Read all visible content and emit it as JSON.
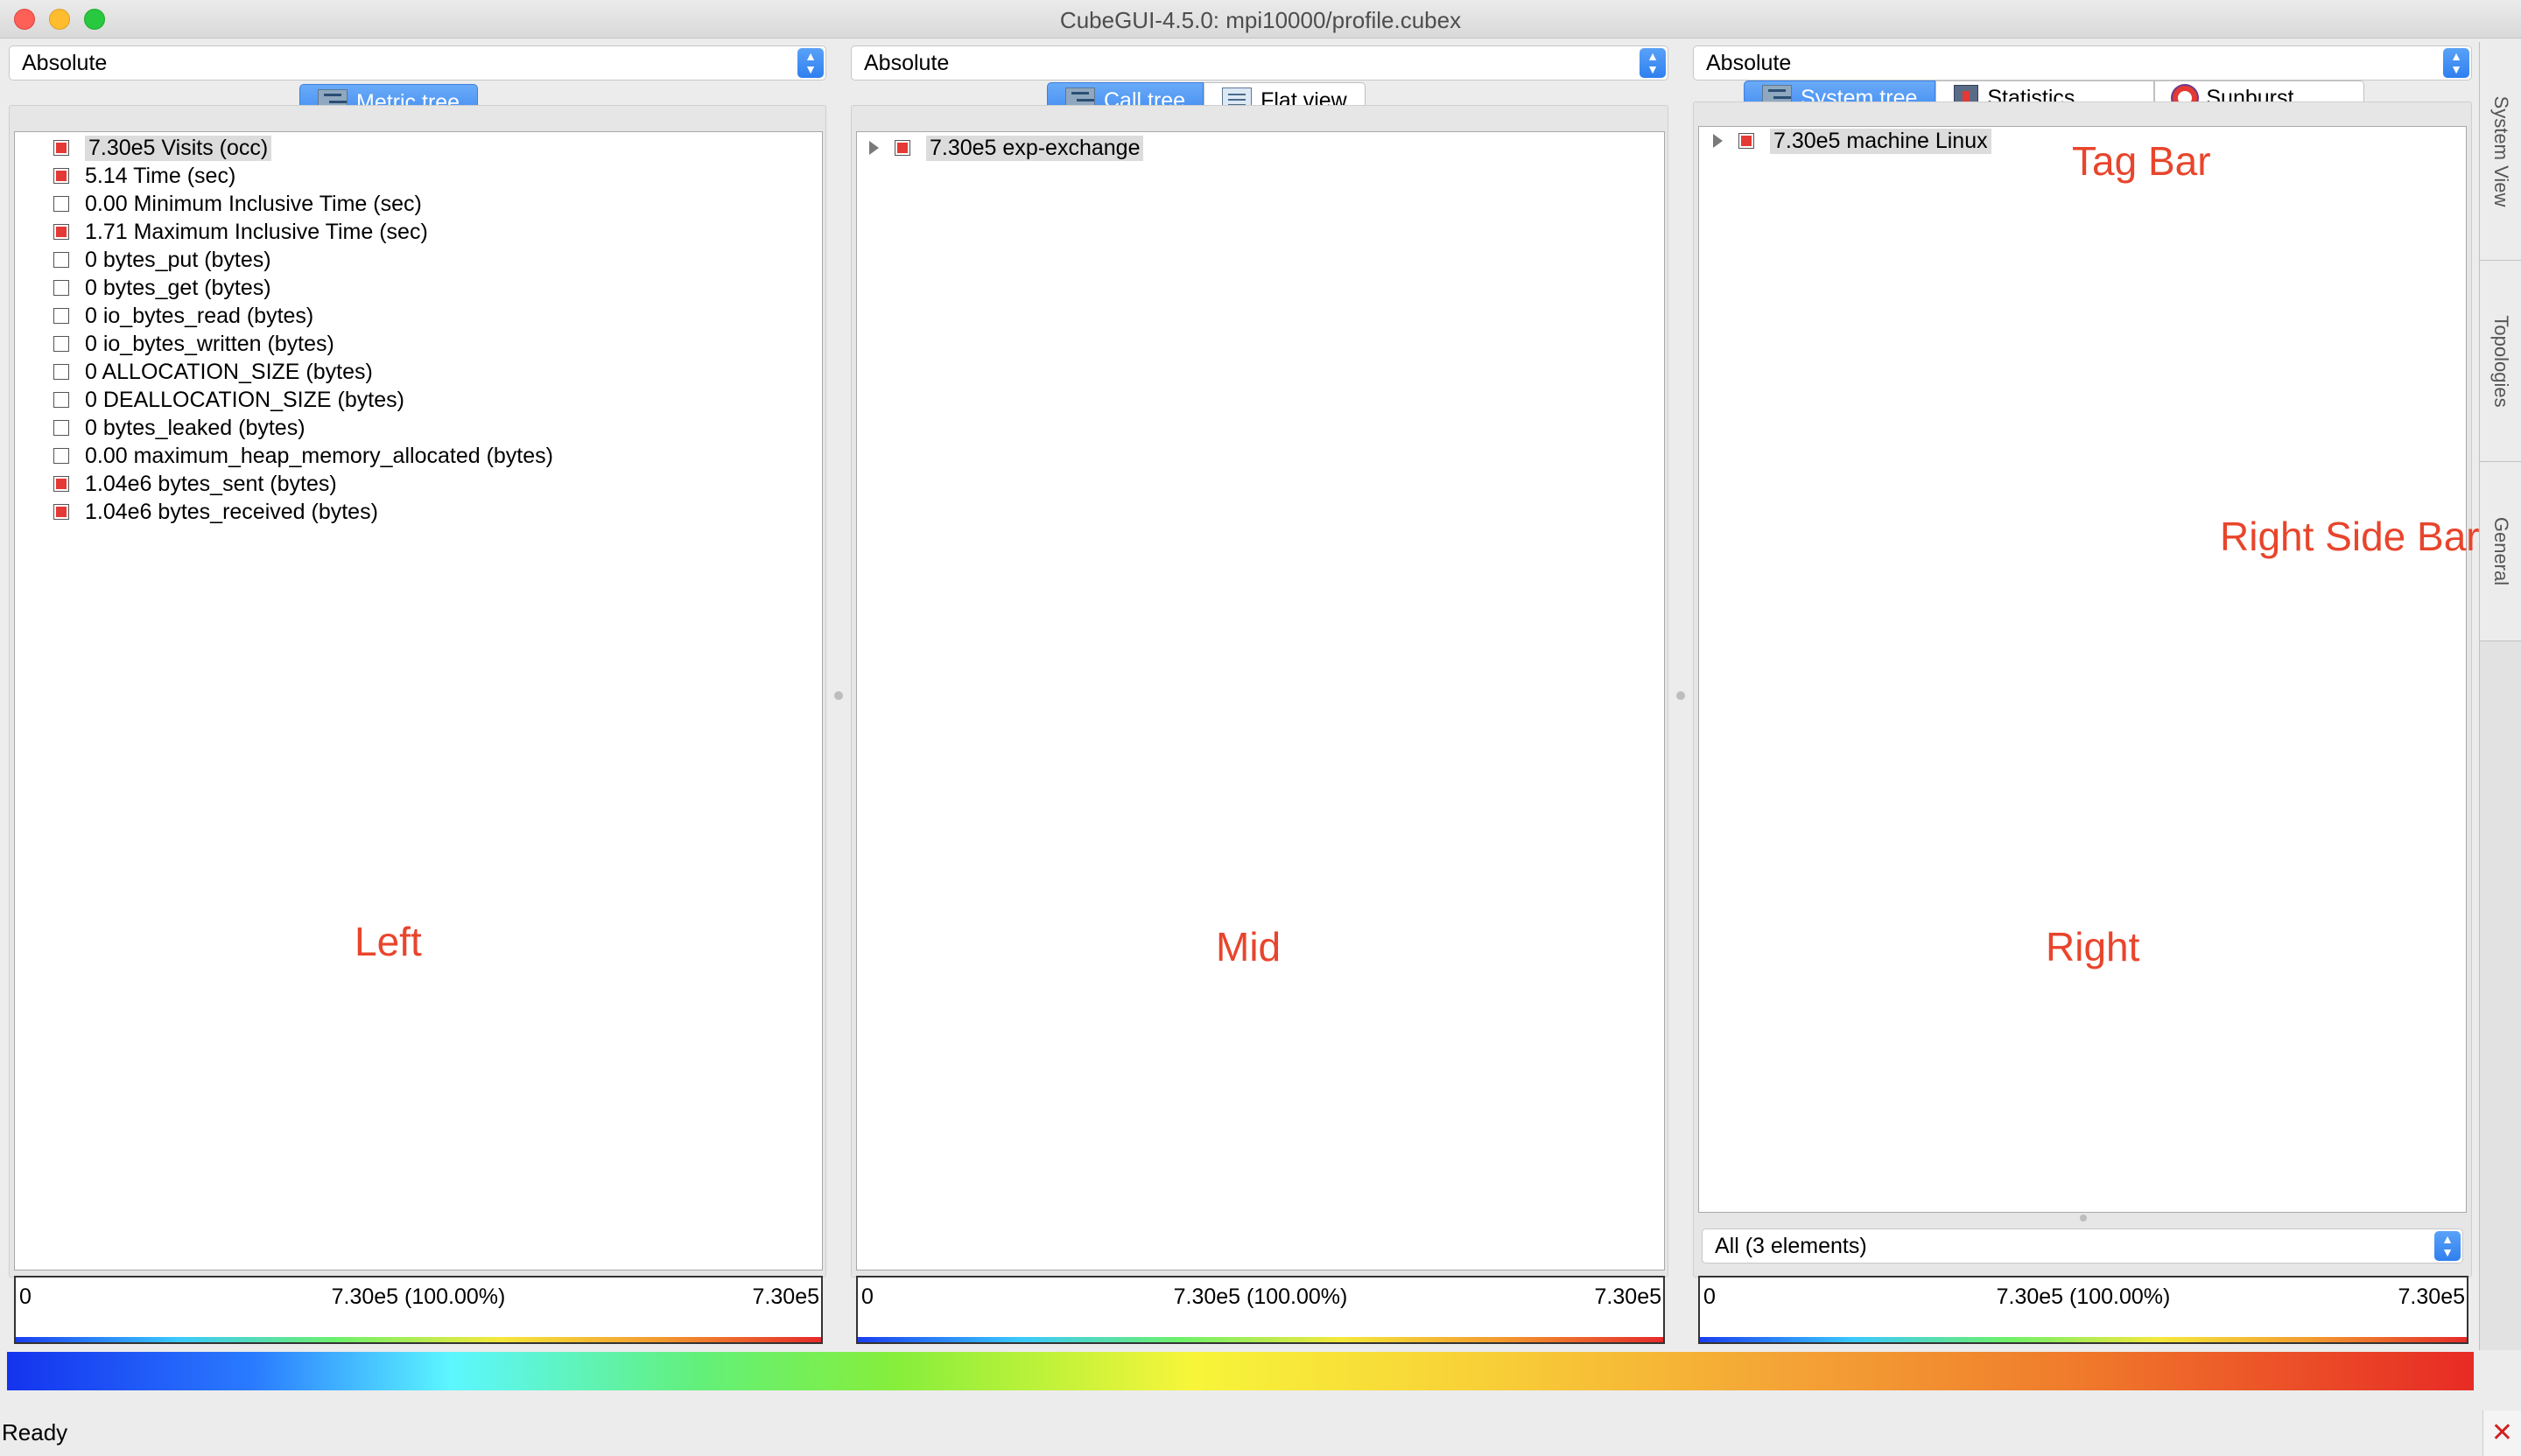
{
  "window": {
    "title": "CubeGUI-4.5.0: mpi10000/profile.cubex"
  },
  "left": {
    "mode": "Absolute",
    "tabs": [
      {
        "label": "Metric tree",
        "icon": "tree-icon",
        "active": true
      }
    ],
    "rows": [
      {
        "label": "7.30e5 Visits (occ)",
        "color": "red",
        "selected": true
      },
      {
        "label": "5.14 Time (sec)",
        "color": "red"
      },
      {
        "label": "0.00 Minimum Inclusive Time (sec)",
        "color": "white"
      },
      {
        "label": "1.71 Maximum Inclusive Time (sec)",
        "color": "red"
      },
      {
        "label": "0 bytes_put (bytes)",
        "color": "white"
      },
      {
        "label": "0 bytes_get (bytes)",
        "color": "white"
      },
      {
        "label": "0 io_bytes_read (bytes)",
        "color": "white"
      },
      {
        "label": "0 io_bytes_written (bytes)",
        "color": "white"
      },
      {
        "label": "0 ALLOCATION_SIZE (bytes)",
        "color": "white"
      },
      {
        "label": "0 DEALLOCATION_SIZE (bytes)",
        "color": "white"
      },
      {
        "label": "0 bytes_leaked (bytes)",
        "color": "white"
      },
      {
        "label": "0.00 maximum_heap_memory_allocated (bytes)",
        "color": "white"
      },
      {
        "label": "1.04e6 bytes_sent (bytes)",
        "color": "red"
      },
      {
        "label": "1.04e6 bytes_received (bytes)",
        "color": "red"
      }
    ],
    "valuebar": {
      "min": "0",
      "mid": "7.30e5 (100.00%)",
      "max": "7.30e5"
    },
    "annotation": "Left"
  },
  "mid": {
    "mode": "Absolute",
    "tabs": [
      {
        "label": "Call tree",
        "icon": "tree-icon",
        "active": true
      },
      {
        "label": "Flat view",
        "icon": "flat-icon",
        "active": false
      }
    ],
    "rows": [
      {
        "label": "7.30e5 exp-exchange",
        "color": "red",
        "expandable": true,
        "selected": true
      }
    ],
    "valuebar": {
      "min": "0",
      "mid": "7.30e5 (100.00%)",
      "max": "7.30e5"
    },
    "annotation": "Mid"
  },
  "right": {
    "mode": "Absolute",
    "tabs": [
      {
        "label": "System tree",
        "icon": "tree-icon",
        "active": true
      },
      {
        "label": "Statistics",
        "icon": "stats-icon",
        "active": false
      },
      {
        "label": "Sunburst",
        "icon": "sunburst-icon",
        "active": false
      }
    ],
    "rows": [
      {
        "label": "7.30e5 machine Linux",
        "color": "red",
        "expandable": true,
        "selected": true
      }
    ],
    "filter": "All (3 elements)",
    "valuebar": {
      "min": "0",
      "mid": "7.30e5 (100.00%)",
      "max": "7.30e5"
    },
    "annotation": "Right",
    "tagbar_annotation": "Tag Bar"
  },
  "sidebar": {
    "tabs": [
      "System View",
      "Topologies",
      "General"
    ],
    "annotation": "Right Side Bar"
  },
  "status": {
    "text": "Ready",
    "icon": "close-x-icon"
  },
  "colors": {
    "accent": "#3d88f1",
    "checkbox_red": "#e53935",
    "annotation": "#e8452c"
  }
}
